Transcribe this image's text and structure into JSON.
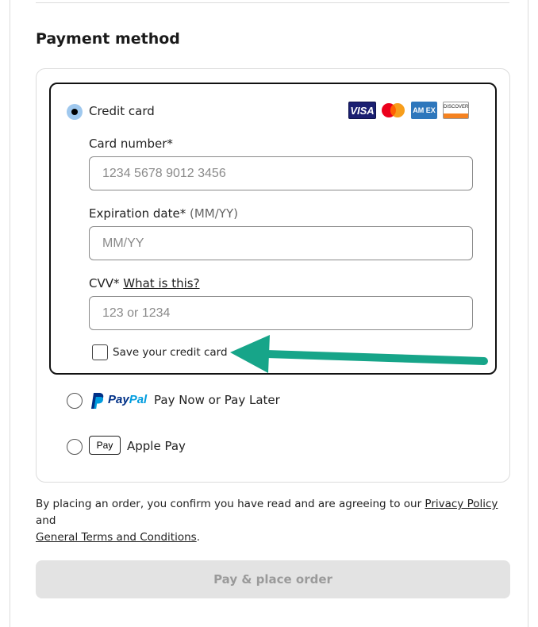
{
  "section_title": "Payment method",
  "credit_card": {
    "label": "Credit card",
    "selected": true,
    "card_brands": [
      "VISA",
      "Mastercard",
      "American Express",
      "DISCOVER"
    ],
    "visa_text": "VISA",
    "amex_text": "AM EX",
    "discover_text": "DISCOVER",
    "card_number": {
      "label": "Card number*",
      "placeholder": "1234 5678 9012 3456"
    },
    "expiration": {
      "label": "Expiration date*",
      "hint": "(MM/YY)",
      "placeholder": "MM/YY"
    },
    "cvv": {
      "label": "CVV*",
      "link": "What is this?",
      "placeholder": "123 or 1234"
    },
    "save_card": {
      "label": "Save your credit card",
      "checked": false
    }
  },
  "paypal": {
    "logo_text_pay": "Pay",
    "logo_text_pal": "Pal",
    "label": "Pay Now or Pay Later",
    "selected": false
  },
  "apple_pay": {
    "badge_text": "Pay",
    "label": "Apple Pay",
    "selected": false
  },
  "legal": {
    "prefix": "By placing an order, you confirm you have read and are agreeing to our ",
    "privacy_link": "Privacy Policy",
    "middle": " and ",
    "terms_link": "General Terms and Conditions",
    "suffix": "."
  },
  "order_button": {
    "label": "Pay & place order",
    "disabled": true
  },
  "colors": {
    "annotation_arrow": "#17a589",
    "radio_selected": "#9fc8ee",
    "button_disabled_bg": "#e3e3e3",
    "visa_blue": "#1a1f71",
    "paypal_dark": "#003087",
    "paypal_light": "#009cde"
  }
}
